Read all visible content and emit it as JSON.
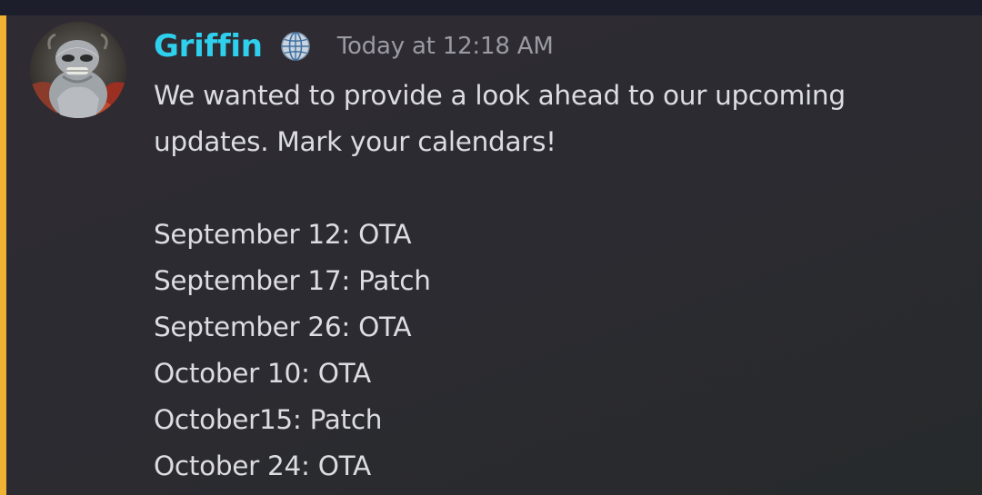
{
  "message": {
    "author": "Griffin",
    "author_color": "#2fd0ee",
    "author_badge_icon": "globe-icon",
    "avatar_icon": "creature-avatar",
    "timestamp": "Today at 12:18 AM",
    "mention_highlight_color": "#f0b232",
    "intro_lines": [
      "We wanted to provide a look ahead to our upcoming",
      "updates. Mark your calendars!"
    ],
    "schedule": [
      "September 12: OTA",
      "September 17: Patch",
      "September 26: OTA",
      "October 10: OTA",
      "October15: Patch",
      "October 24: OTA"
    ]
  }
}
